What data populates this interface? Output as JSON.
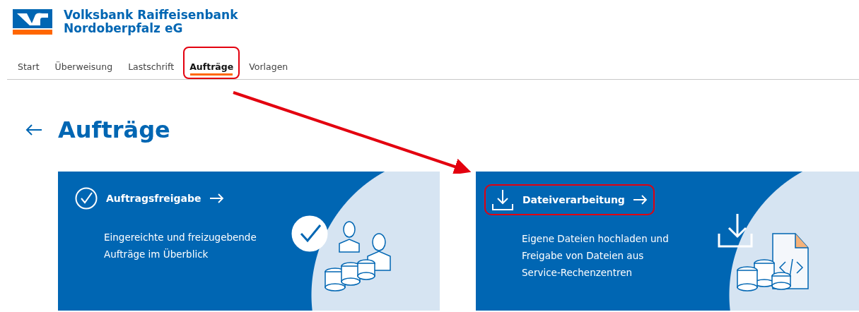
{
  "bank_name": [
    "Volksbank Raiffeisenbank",
    "Nordoberpfalz eG"
  ],
  "tabs": [
    {
      "label": "Start",
      "selected": false,
      "highlighted": false
    },
    {
      "label": "Überweisung",
      "selected": false,
      "highlighted": false
    },
    {
      "label": "Lastschrift",
      "selected": false,
      "highlighted": false
    },
    {
      "label": "Aufträge",
      "selected": true,
      "highlighted": true
    },
    {
      "label": "Vorlagen",
      "selected": false,
      "highlighted": false
    }
  ],
  "page_title": "Aufträge",
  "cards": [
    {
      "kind": "approval",
      "title": "Auftragsfreigabe",
      "description": [
        "Eingereichte und freizugebende",
        "Aufträge im Überblick"
      ],
      "highlighted": false
    },
    {
      "kind": "files",
      "title": "Dateiverarbeitung",
      "description": [
        "Eigene Dateien hochladen und",
        "Freigabe von Dateien aus",
        "Service-Rechenzentren"
      ],
      "highlighted": true
    }
  ]
}
